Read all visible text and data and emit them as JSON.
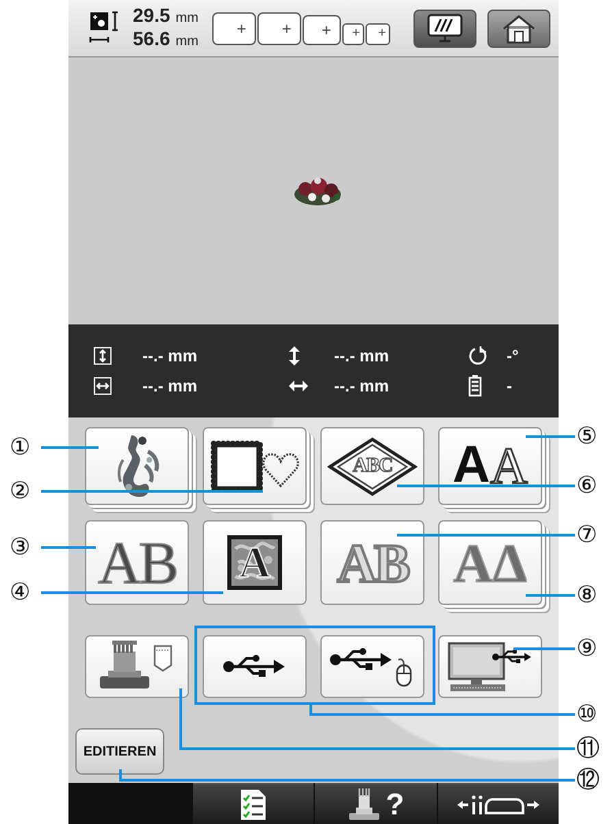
{
  "top_bar": {
    "height_value": "29.5",
    "height_unit": "mm",
    "width_value": "56.6",
    "width_unit": "mm",
    "hoop_buttons": [
      {
        "label": "+"
      },
      {
        "label": "+"
      },
      {
        "label": "+"
      },
      {
        "label": "+"
      },
      {
        "label": "+"
      }
    ]
  },
  "info_panel": {
    "rows": [
      {
        "first": "--.- mm",
        "second": "--.- mm",
        "third": "-°"
      },
      {
        "first": "--.- mm",
        "second": "--.- mm",
        "third": "-"
      }
    ]
  },
  "pattern_buttons": [
    {
      "kind": "design",
      "stacked": true
    },
    {
      "kind": "frame",
      "stacked": true
    },
    {
      "kind": "monogram",
      "stacked": false,
      "glyphs": [
        {
          "text": "ABC",
          "kind": "monogram"
        }
      ]
    },
    {
      "kind": "font",
      "stacked": true,
      "glyphs": [
        {
          "text": "A",
          "kind": "solid"
        },
        {
          "text": "A",
          "kind": "outline"
        }
      ]
    },
    {
      "kind": "letters",
      "stacked": false,
      "glyphs": [
        {
          "text": "AB",
          "kind": "floral"
        }
      ]
    },
    {
      "kind": "decorative",
      "stacked": false,
      "glyphs": [
        {
          "text": "A",
          "kind": "decorative"
        }
      ]
    },
    {
      "kind": "letters",
      "stacked": false,
      "glyphs": [
        {
          "text": "AB",
          "kind": "applique"
        }
      ]
    },
    {
      "kind": "letters",
      "stacked": true,
      "glyphs": [
        {
          "text": "AΔ",
          "kind": "stitched"
        }
      ]
    },
    {
      "kind": "machine",
      "stacked": false
    },
    {
      "kind": "usb",
      "stacked": false
    },
    {
      "kind": "usb-mouse",
      "stacked": false
    },
    {
      "kind": "computer",
      "stacked": false
    }
  ],
  "edit_button": {
    "label": "EDITIEREN"
  },
  "bottom_bar": [
    {
      "kind": "checklist"
    },
    {
      "kind": "help",
      "label": "?"
    },
    {
      "kind": "frame-move"
    }
  ],
  "callouts": [
    {
      "label": "①"
    },
    {
      "label": "②"
    },
    {
      "label": "③"
    },
    {
      "label": "④"
    },
    {
      "label": "⑤"
    },
    {
      "label": "⑥"
    },
    {
      "label": "⑦"
    },
    {
      "label": "⑧"
    },
    {
      "label": "⑨"
    },
    {
      "label": "⑩"
    },
    {
      "label": "⑪"
    },
    {
      "label": "⑫"
    }
  ]
}
